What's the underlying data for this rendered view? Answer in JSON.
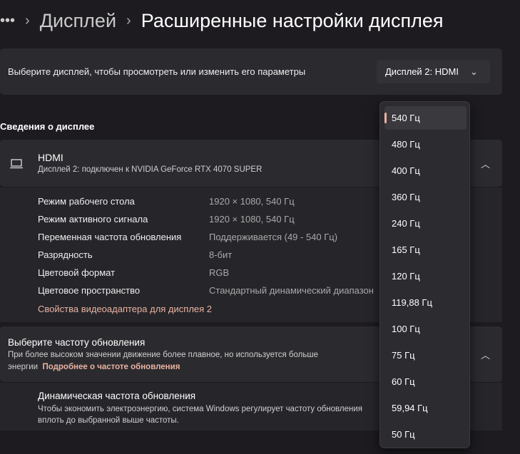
{
  "breadcrumb": {
    "more": "•••",
    "parent": "Дисплей",
    "current": "Расширенные настройки дисплея"
  },
  "display_select": {
    "label": "Выберите дисплей, чтобы просмотреть или изменить его параметры",
    "value": "Дисплей 2: HDMI"
  },
  "info_section": {
    "title": "Сведения о дисплее"
  },
  "display_card": {
    "name": "HDMI",
    "description": "Дисплей 2: подключен к NVIDIA GeForce RTX 4070 SUPER",
    "rows": [
      {
        "label": "Режим рабочего стола",
        "value": "1920 × 1080, 540 Гц"
      },
      {
        "label": "Режим активного сигнала",
        "value": "1920 × 1080, 540 Гц"
      },
      {
        "label": "Переменная частота обновления",
        "value": "Поддерживается (49 - 540 Гц)"
      },
      {
        "label": "Разрядность",
        "value": "8-бит"
      },
      {
        "label": "Цветовой формат",
        "value": "RGB"
      },
      {
        "label": "Цветовое пространство",
        "value": "Стандартный динамический диапазон"
      }
    ],
    "adapter_link": "Свойства видеоадаптера для дисплея 2"
  },
  "refresh": {
    "title": "Выберите частоту обновления",
    "description": "При более высоком значении движение более плавное, но используется больше",
    "description2": "энергии",
    "link": "Подробнее о частоте обновления",
    "dynamic_title": "Динамическая частота обновления",
    "dynamic_desc": "Чтобы экономить электроэнергию, система Windows регулирует частоту обновления",
    "dynamic_desc2": "вплоть до выбранной выше частоты."
  },
  "refresh_options": {
    "selected": "540 Гц",
    "items": [
      "540 Гц",
      "480 Гц",
      "400 Гц",
      "360 Гц",
      "240 Гц",
      "165 Гц",
      "120 Гц",
      "119,88 Гц",
      "100 Гц",
      "75 Гц",
      "60 Гц",
      "59,94 Гц",
      "50 Гц"
    ]
  }
}
